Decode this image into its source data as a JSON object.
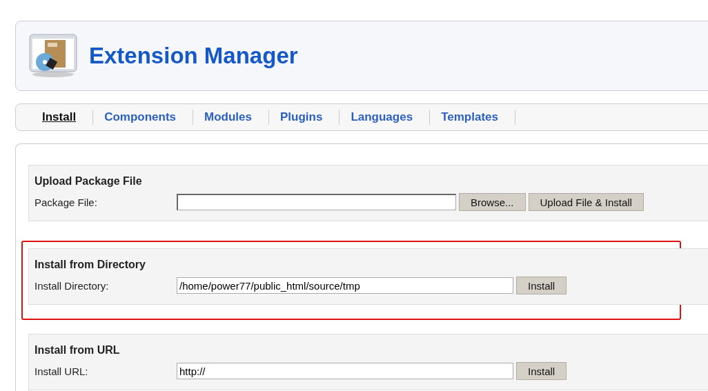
{
  "header": {
    "title": "Extension Manager"
  },
  "tabs": [
    {
      "label": "Install",
      "selected": true
    },
    {
      "label": "Components",
      "selected": false
    },
    {
      "label": "Modules",
      "selected": false
    },
    {
      "label": "Plugins",
      "selected": false
    },
    {
      "label": "Languages",
      "selected": false
    },
    {
      "label": "Templates",
      "selected": false
    }
  ],
  "sections": [
    {
      "title": "Upload Package File",
      "label": "Package File:",
      "kind": "file",
      "highlighted": false,
      "buttons": [
        "Browse...",
        "Upload File & Install"
      ]
    },
    {
      "title": "Install from Directory",
      "label": "Install Directory:",
      "kind": "text",
      "value": "/home/power77/public_html/source/tmp",
      "highlighted": true,
      "buttons": [
        "Install"
      ]
    },
    {
      "title": "Install from URL",
      "label": "Install URL:",
      "kind": "text",
      "value": "http://",
      "highlighted": false,
      "buttons": [
        "Install"
      ]
    }
  ]
}
